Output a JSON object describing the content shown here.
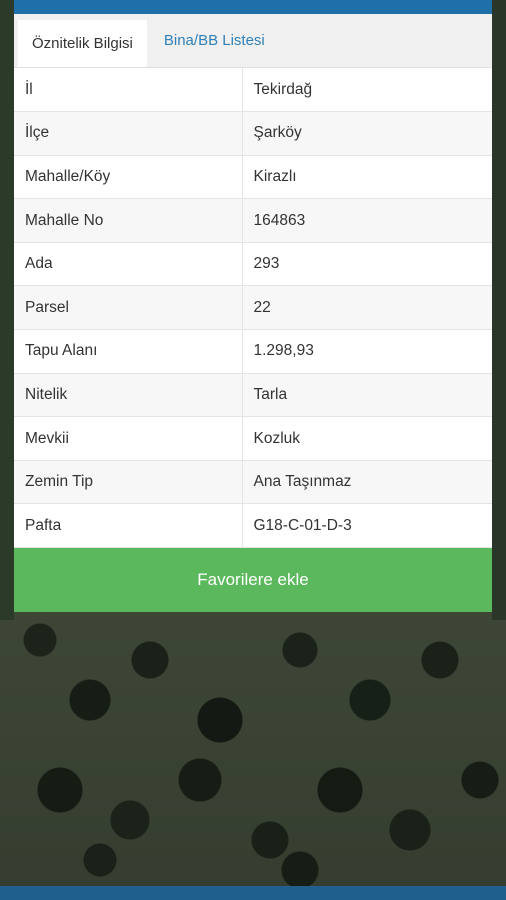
{
  "tabs": [
    {
      "label": "Öznitelik Bilgisi",
      "active": true
    },
    {
      "label": "Bina/BB Listesi",
      "active": false
    }
  ],
  "attributes": [
    {
      "key": "İl",
      "value": "Tekirdağ"
    },
    {
      "key": "İlçe",
      "value": "Şarköy"
    },
    {
      "key": "Mahalle/Köy",
      "value": "Kirazlı"
    },
    {
      "key": "Mahalle No",
      "value": "164863"
    },
    {
      "key": "Ada",
      "value": "293"
    },
    {
      "key": "Parsel",
      "value": "22"
    },
    {
      "key": "Tapu Alanı",
      "value": "1.298,93"
    },
    {
      "key": "Nitelik",
      "value": "Tarla"
    },
    {
      "key": "Mevkii",
      "value": "Kozluk"
    },
    {
      "key": "Zemin Tip",
      "value": "Ana Taşınmaz"
    },
    {
      "key": "Pafta",
      "value": "G18-C-01-D-3"
    }
  ],
  "favorite_button": {
    "label": "Favorilere ekle"
  },
  "colors": {
    "tab_link": "#2f80b8",
    "button_green": "#5cb85c",
    "header_blue": "#1f6fa8"
  }
}
